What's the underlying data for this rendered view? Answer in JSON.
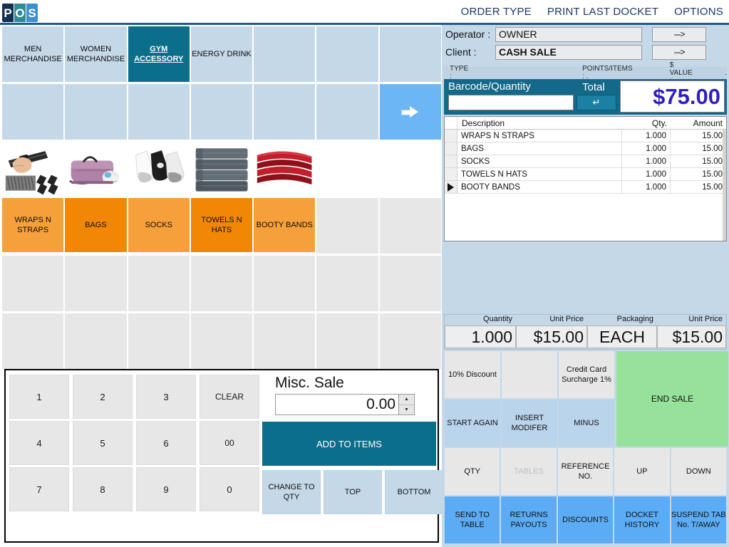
{
  "app": {
    "logo_letters": [
      "P",
      "O",
      "S"
    ]
  },
  "topnav": {
    "items": [
      {
        "label": "ORDER TYPE"
      },
      {
        "label": "PRINT LAST DOCKET"
      },
      {
        "label": "OPTIONS"
      }
    ]
  },
  "categories": {
    "row": [
      {
        "label": "MEN MERCHANDISE",
        "selected": false
      },
      {
        "label": "WOMEN MERCHANDISE",
        "selected": false
      },
      {
        "label": "GYM ACCESSORY",
        "selected": true
      },
      {
        "label": "ENERGY DRINK",
        "selected": false
      },
      {
        "label": "",
        "selected": false
      },
      {
        "label": "",
        "selected": false
      },
      {
        "label": "",
        "selected": false
      }
    ]
  },
  "nav_tile": {
    "icon": "right-arrow-icon"
  },
  "products": {
    "images": [
      {
        "name": "wrist-wraps-photo"
      },
      {
        "name": "gym-bag-photo"
      },
      {
        "name": "socks-photo"
      },
      {
        "name": "towels-photo"
      },
      {
        "name": "booty-band-photo"
      }
    ],
    "buttons": [
      {
        "label": "WRAPS N STRAPS",
        "color": "#f6a03c"
      },
      {
        "label": "BAGS",
        "color": "#f28706"
      },
      {
        "label": "SOCKS",
        "color": "#f6a03c"
      },
      {
        "label": "TOWELS N HATS",
        "color": "#f28706"
      },
      {
        "label": "BOOTY BANDS",
        "color": "#f6a03c"
      }
    ]
  },
  "keypad": {
    "rows": [
      [
        "1",
        "2",
        "3",
        "CLEAR"
      ],
      [
        "4",
        "5",
        "6",
        "00"
      ],
      [
        "7",
        "8",
        "9",
        "0"
      ]
    ],
    "misc_label": "Misc. Sale",
    "misc_value": "0.00",
    "add_to_items": "ADD TO ITEMS",
    "extras": [
      "CHANGE TO QTY",
      "TOP",
      "BOTTOM"
    ]
  },
  "operator_panel": {
    "operator_label": "Operator :",
    "operator_value": "OWNER",
    "client_label": "Client :",
    "client_value": "CASH SALE",
    "arrow_glyph": "--->",
    "type_label": "TYPE :",
    "type_value": "",
    "points_label": "POINTS/ITEMS : .",
    "value_label": "$ VALUE :",
    "value_value": "."
  },
  "barcode": {
    "label": "Barcode/Quantity",
    "total_label": "Total",
    "input_value": "",
    "enter_glyph": "↵",
    "total_amount": "$75.00"
  },
  "items_table": {
    "columns": [
      "Description",
      "Qty.",
      "Amount"
    ],
    "rows": [
      {
        "selected": false,
        "description": "WRAPS N STRAPS",
        "qty": "1.000",
        "amount": "15.00"
      },
      {
        "selected": false,
        "description": "BAGS",
        "qty": "1.000",
        "amount": "15.00"
      },
      {
        "selected": false,
        "description": "SOCKS",
        "qty": "1.000",
        "amount": "15.00"
      },
      {
        "selected": false,
        "description": "TOWELS N HATS",
        "qty": "1.000",
        "amount": "15.00"
      },
      {
        "selected": true,
        "description": "BOOTY BANDS",
        "qty": "1.000",
        "amount": "15.00"
      }
    ]
  },
  "price_bar": {
    "labels": [
      "Quantity",
      "Unit Price",
      "Packaging",
      "Unit Price"
    ],
    "values": [
      "1.000",
      "$15.00",
      "EACH",
      "$15.00"
    ]
  },
  "actions": {
    "row1": [
      {
        "label": "10% Discount",
        "style": "grey"
      },
      {
        "label": "",
        "style": "grey"
      },
      {
        "label": "Credit Card Surcharge 1%",
        "style": "grey"
      }
    ],
    "row2": [
      {
        "label": "START AGAIN",
        "style": "lblue"
      },
      {
        "label": "INSERT MODIFER",
        "style": "lblue"
      },
      {
        "label": "MINUS",
        "style": "lblue"
      }
    ],
    "row3": [
      {
        "label": "QTY",
        "style": "grey"
      },
      {
        "label": "TABLES",
        "style": "dim"
      },
      {
        "label": "REFERENCE NO.",
        "style": "grey"
      },
      {
        "label": "UP",
        "style": "grey"
      },
      {
        "label": "DOWN",
        "style": "grey"
      }
    ],
    "row4": [
      {
        "label": "SEND TO TABLE",
        "style": "blue"
      },
      {
        "label": "RETURNS PAYOUTS",
        "style": "blue"
      },
      {
        "label": "DISCOUNTS",
        "style": "blue"
      },
      {
        "label": "DOCKET HISTORY",
        "style": "blue"
      },
      {
        "label": "SUSPEND TAB No. T/AWAY",
        "style": "blue"
      }
    ],
    "end_sale": "END SALE"
  },
  "colors": {
    "accent_teal": "#0b6e8a",
    "header_blue": "#1f3864",
    "tile_blue": "#c5d8e8",
    "arrow_tile": "#6cb6f5",
    "orange_light": "#f6a03c",
    "orange_dark": "#f28706",
    "end_sale_green": "#96e29a",
    "total_purple": "#2f1fbf",
    "action_blue": "#5bacf5"
  }
}
